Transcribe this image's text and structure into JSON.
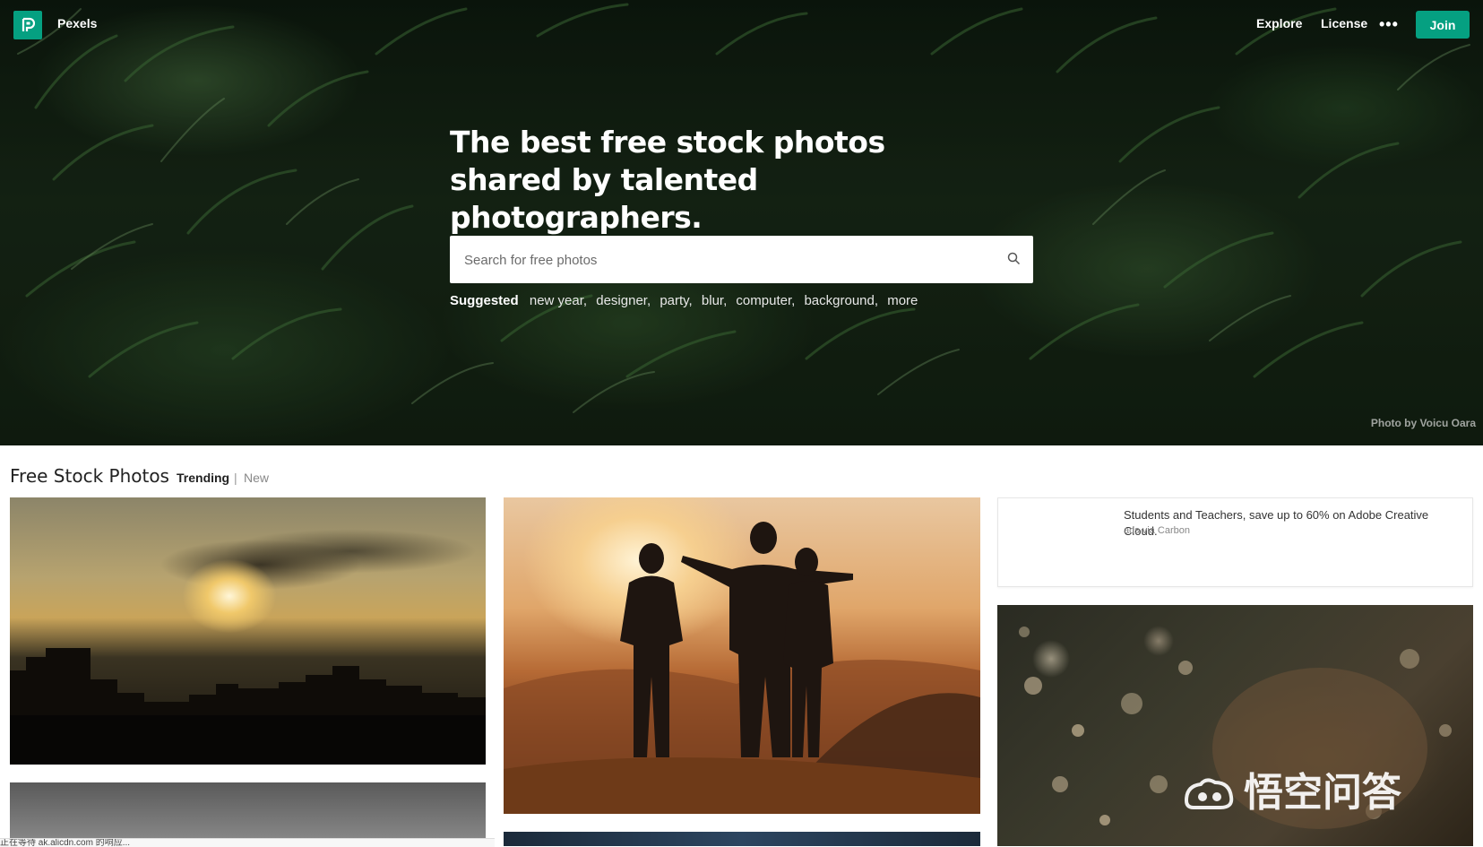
{
  "header": {
    "brand": "Pexels",
    "nav": {
      "explore": "Explore",
      "license": "License",
      "more": "•••"
    },
    "join": "Join"
  },
  "hero": {
    "headline": "The best free stock photos shared by talented photographers.",
    "search_placeholder": "Search for free photos",
    "suggested_label": "Suggested",
    "suggested_tags": [
      "new year",
      "designer",
      "party",
      "blur",
      "computer",
      "background",
      "more"
    ],
    "credit": "Photo by Voicu Oara"
  },
  "content": {
    "section_title": "Free Stock Photos",
    "filters": {
      "trending": "Trending",
      "divider": "|",
      "new": "New"
    },
    "ad": {
      "text": "Students and Teachers, save up to 60% on Adobe Creative Cloud.",
      "via": "ads via Carbon"
    }
  },
  "watermark": "悟空问答",
  "status_text": "正在等待 ak.alicdn.com 的响应...",
  "colors": {
    "accent": "#05a081"
  }
}
